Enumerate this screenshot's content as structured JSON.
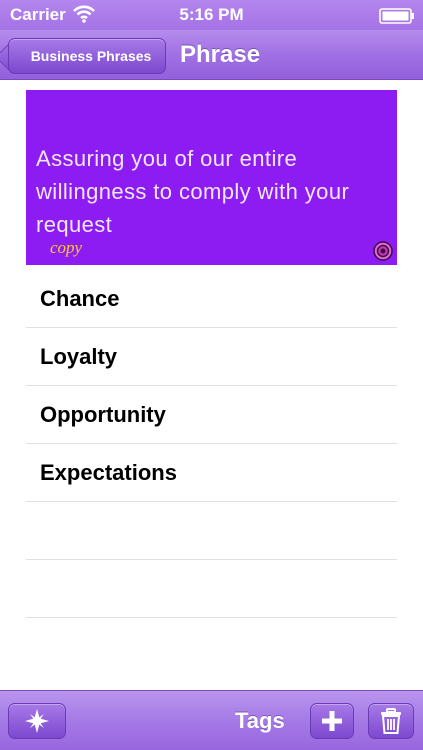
{
  "status_bar": {
    "carrier": "Carrier",
    "time": "5:16 PM"
  },
  "nav": {
    "back_label": "Business Phrases",
    "title": "Phrase"
  },
  "phrase": {
    "text": "Assuring you of our entire willingness to comply with your request",
    "copy_label": "copy"
  },
  "tags": [
    {
      "label": "Chance"
    },
    {
      "label": "Loyalty"
    },
    {
      "label": "Opportunity"
    },
    {
      "label": "Expectations"
    },
    {
      "label": ""
    },
    {
      "label": ""
    },
    {
      "label": ""
    }
  ],
  "toolbar": {
    "tags_label": "Tags",
    "favorite_icon": "star-icon",
    "add_icon": "plus-icon",
    "delete_icon": "trash-icon"
  },
  "colors": {
    "accent": "#a070e4",
    "card": "#8c1cf2",
    "copy": "#ffc72c"
  }
}
